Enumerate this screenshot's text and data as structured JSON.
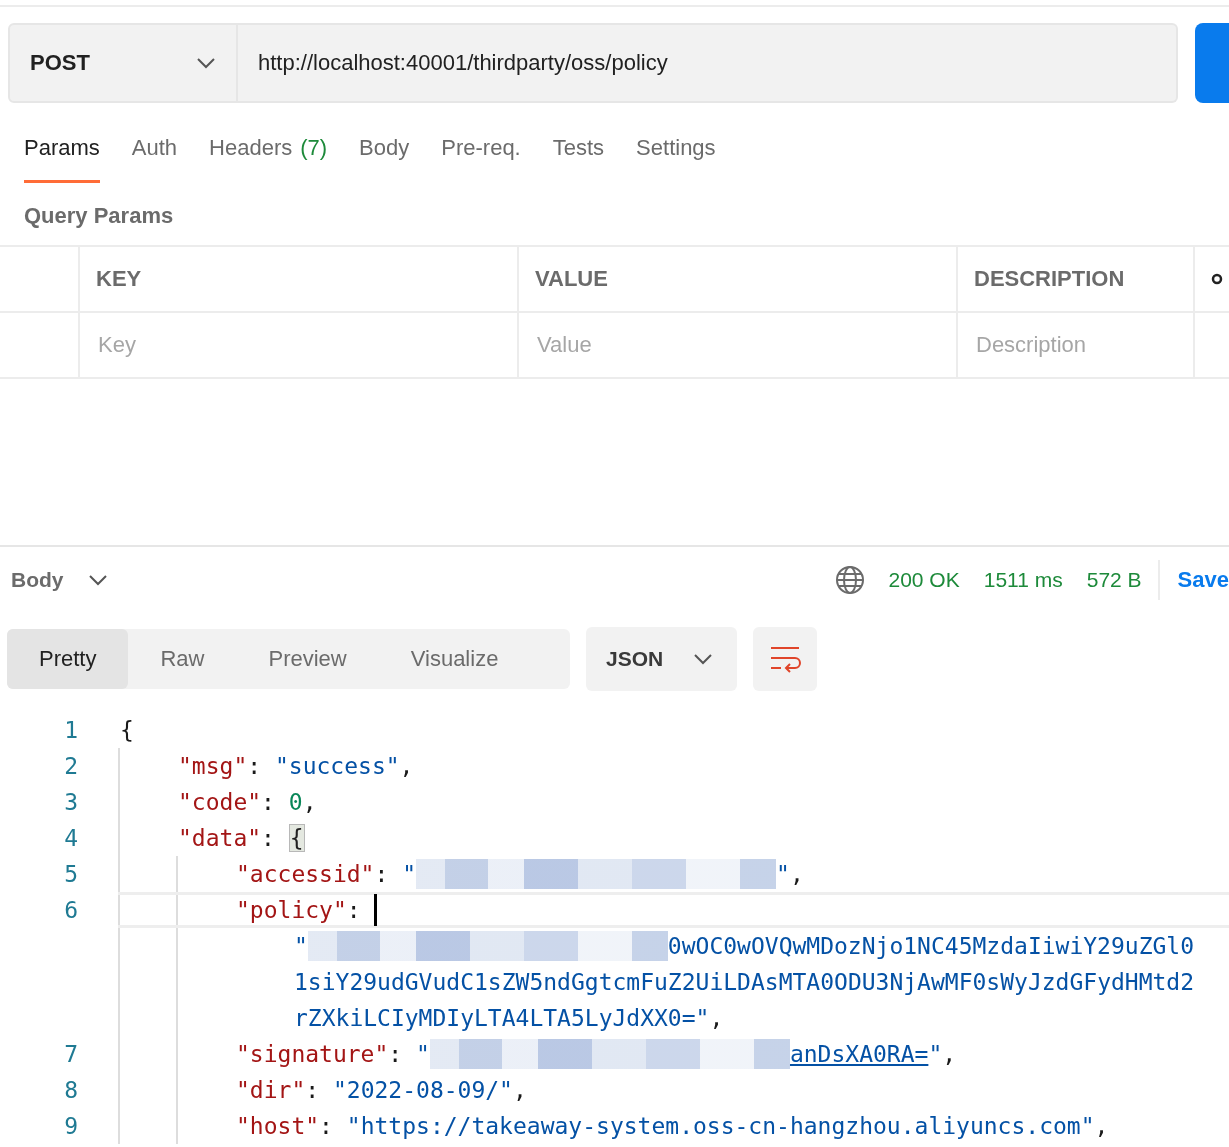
{
  "request": {
    "method": "POST",
    "url": "http://localhost:40001/thirdparty/oss/policy"
  },
  "tabs": [
    {
      "label": "Params",
      "selected": true
    },
    {
      "label": "Auth",
      "selected": false
    },
    {
      "label": "Headers",
      "count": "(7)",
      "selected": false
    },
    {
      "label": "Body",
      "selected": false
    },
    {
      "label": "Pre-req.",
      "selected": false
    },
    {
      "label": "Tests",
      "selected": false
    },
    {
      "label": "Settings",
      "selected": false
    }
  ],
  "query_params": {
    "title": "Query Params",
    "columns": [
      "KEY",
      "VALUE",
      "DESCRIPTION"
    ],
    "placeholders": [
      "Key",
      "Value",
      "Description"
    ]
  },
  "response": {
    "section": "Body",
    "status": "200 OK",
    "time": "1511 ms",
    "size": "572 B",
    "save": "Save",
    "views": [
      {
        "label": "Pretty",
        "selected": true
      },
      {
        "label": "Raw",
        "selected": false
      },
      {
        "label": "Preview",
        "selected": false
      },
      {
        "label": "Visualize",
        "selected": false
      }
    ],
    "format": "JSON"
  },
  "code_lines": [
    {
      "number": "1",
      "current": false,
      "tokens": [
        {
          "kind": "punct",
          "text": "{"
        }
      ],
      "children": [
        {
          "number": "2",
          "current": false,
          "tokens": [
            {
              "kind": "key",
              "text": "\"msg\""
            },
            {
              "kind": "punct",
              "text": ": "
            },
            {
              "kind": "string",
              "text": "\"success\""
            },
            {
              "kind": "punct",
              "text": ","
            }
          ]
        },
        {
          "number": "3",
          "current": false,
          "tokens": [
            {
              "kind": "key",
              "text": "\"code\""
            },
            {
              "kind": "punct",
              "text": ": "
            },
            {
              "kind": "number",
              "text": "0"
            },
            {
              "kind": "punct",
              "text": ","
            }
          ]
        },
        {
          "number": "4",
          "current": false,
          "tokens": [
            {
              "kind": "key",
              "text": "\"data\""
            },
            {
              "kind": "punct",
              "text": ": "
            },
            {
              "kind": "brace-match",
              "text": "{"
            }
          ],
          "children": [
            {
              "number": "5",
              "current": false,
              "tokens": [
                {
                  "kind": "key",
                  "text": "\"accessid\""
                },
                {
                  "kind": "punct",
                  "text": ": "
                },
                {
                  "kind": "string",
                  "text": "\""
                },
                {
                  "kind": "blur"
                },
                {
                  "kind": "string",
                  "text": "\""
                },
                {
                  "kind": "punct",
                  "text": ","
                }
              ]
            },
            {
              "number": "6",
              "current": true,
              "tokens": [
                {
                  "kind": "key",
                  "text": "\"policy\""
                },
                {
                  "kind": "punct",
                  "text": ": "
                },
                {
                  "kind": "caret"
                }
              ],
              "children": [
                {
                  "current": false,
                  "tokens": [
                    {
                      "kind": "string",
                      "text": "\""
                    },
                    {
                      "kind": "blur"
                    },
                    {
                      "kind": "string",
                      "text": "0wOC0wOVQwMDozNjo1NC45MzdaIiwiY29uZGl0"
                    }
                  ]
                },
                {
                  "current": false,
                  "tokens": [
                    {
                      "kind": "string",
                      "text": "1siY29udGVudC1sZW5ndGgtcmFuZ2UiLDAsMTA0ODU3NjAwMF0sWyJzdGFydHMtd2"
                    }
                  ]
                },
                {
                  "current": false,
                  "tokens": [
                    {
                      "kind": "string",
                      "text": "rZXkiLCIyMDIyLTA4LTA5LyJdXX0=\""
                    },
                    {
                      "kind": "punct",
                      "text": ","
                    }
                  ]
                }
              ]
            },
            {
              "number": "7",
              "current": false,
              "tokens": [
                {
                  "kind": "key",
                  "text": "\"signature\""
                },
                {
                  "kind": "punct",
                  "text": ": "
                },
                {
                  "kind": "string",
                  "text": "\""
                },
                {
                  "kind": "blur"
                },
                {
                  "kind": "underlined",
                  "text": "anDsXA0RA="
                },
                {
                  "kind": "string",
                  "text": "\""
                },
                {
                  "kind": "punct",
                  "text": ","
                }
              ]
            },
            {
              "number": "8",
              "current": false,
              "tokens": [
                {
                  "kind": "key",
                  "text": "\"dir\""
                },
                {
                  "kind": "punct",
                  "text": ": "
                },
                {
                  "kind": "string",
                  "text": "\"2022-08-09/\""
                },
                {
                  "kind": "punct",
                  "text": ","
                }
              ]
            },
            {
              "number": "9",
              "current": false,
              "tokens": [
                {
                  "kind": "key",
                  "text": "\"host\""
                },
                {
                  "kind": "punct",
                  "text": ": "
                },
                {
                  "kind": "string",
                  "text": "\"https://takeaway-system.oss-cn-hangzhou.aliyuncs.com\""
                },
                {
                  "kind": "punct",
                  "text": ","
                }
              ]
            }
          ]
        }
      ]
    }
  ]
}
